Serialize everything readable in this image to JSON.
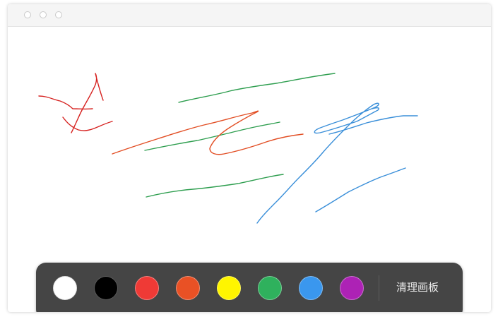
{
  "window": {
    "traffic_lights": [
      "close",
      "minimize",
      "maximize"
    ]
  },
  "canvas": {
    "strokes": [
      {
        "color": "#d6211f",
        "id": "red-1"
      },
      {
        "color": "#d6211f",
        "id": "red-2"
      },
      {
        "color": "#d6211f",
        "id": "red-3"
      },
      {
        "color": "#2e9e4f",
        "id": "green-1"
      },
      {
        "color": "#2e9e4f",
        "id": "green-2"
      },
      {
        "color": "#2e9e4f",
        "id": "green-3"
      },
      {
        "color": "#e24e24",
        "id": "orange-1"
      },
      {
        "color": "#3a8fd9",
        "id": "blue-1"
      },
      {
        "color": "#3a8fd9",
        "id": "blue-2"
      },
      {
        "color": "#3a8fd9",
        "id": "blue-3"
      }
    ]
  },
  "toolbar": {
    "colors": [
      {
        "name": "white",
        "hex": "#ffffff"
      },
      {
        "name": "black",
        "hex": "#000000"
      },
      {
        "name": "red",
        "hex": "#ef3a36"
      },
      {
        "name": "orange",
        "hex": "#e95125"
      },
      {
        "name": "yellow",
        "hex": "#fff500"
      },
      {
        "name": "green",
        "hex": "#2fb15d"
      },
      {
        "name": "blue",
        "hex": "#3a97ee"
      },
      {
        "name": "purple",
        "hex": "#ad22b5"
      }
    ],
    "clear_label": "清理画板"
  }
}
